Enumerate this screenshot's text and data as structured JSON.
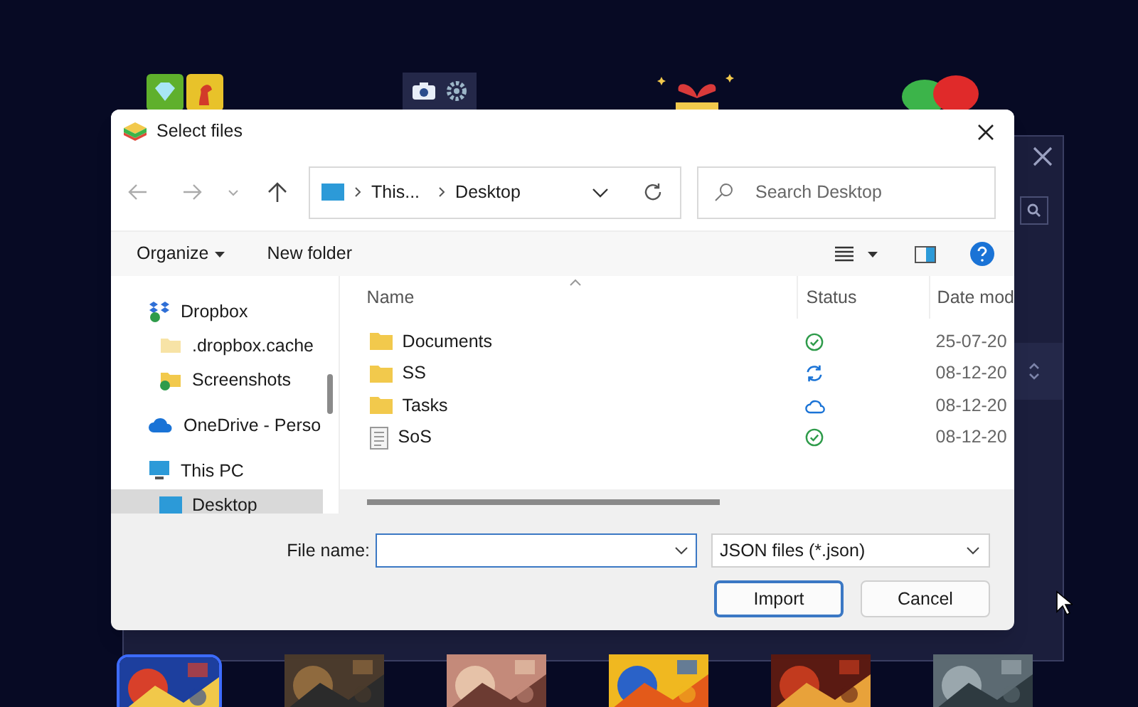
{
  "dialog": {
    "title": "Select files",
    "address": {
      "segments": [
        "This...",
        "Desktop"
      ]
    },
    "search": {
      "placeholder": "Search Desktop"
    },
    "toolbar": {
      "organize": "Organize",
      "new_folder": "New folder"
    },
    "nav": [
      {
        "label": "Dropbox",
        "kind": "dropbox",
        "selected": false,
        "children": [
          {
            "label": ".dropbox.cache",
            "kind": "folder",
            "selected": false
          },
          {
            "label": "Screenshots",
            "kind": "folder-synced",
            "selected": false
          }
        ]
      },
      {
        "label": "OneDrive - Perso",
        "kind": "onedrive",
        "selected": false
      },
      {
        "label": "This PC",
        "kind": "pc",
        "selected": false,
        "children": [
          {
            "label": "Desktop",
            "kind": "desktop",
            "selected": true
          }
        ]
      }
    ],
    "columns": [
      "Name",
      "Status",
      "Date mod"
    ],
    "files": [
      {
        "name": "Documents",
        "kind": "folder",
        "status": {
          "kind": "synced"
        },
        "date": "25-07-20"
      },
      {
        "name": "SS",
        "kind": "folder",
        "status": {
          "kind": "syncing"
        },
        "date": "08-12-20"
      },
      {
        "name": "Tasks",
        "kind": "folder",
        "status": {
          "kind": "cloud"
        },
        "date": "08-12-20"
      },
      {
        "name": "SoS",
        "kind": "file",
        "status": {
          "kind": "synced"
        },
        "date": "08-12-20"
      }
    ],
    "file_name": {
      "label": "File name:"
    },
    "file_type": "JSON files (*.json)",
    "buttons": [
      {
        "label": "Import",
        "default": true
      },
      {
        "label": "Cancel",
        "default": false
      }
    ]
  }
}
